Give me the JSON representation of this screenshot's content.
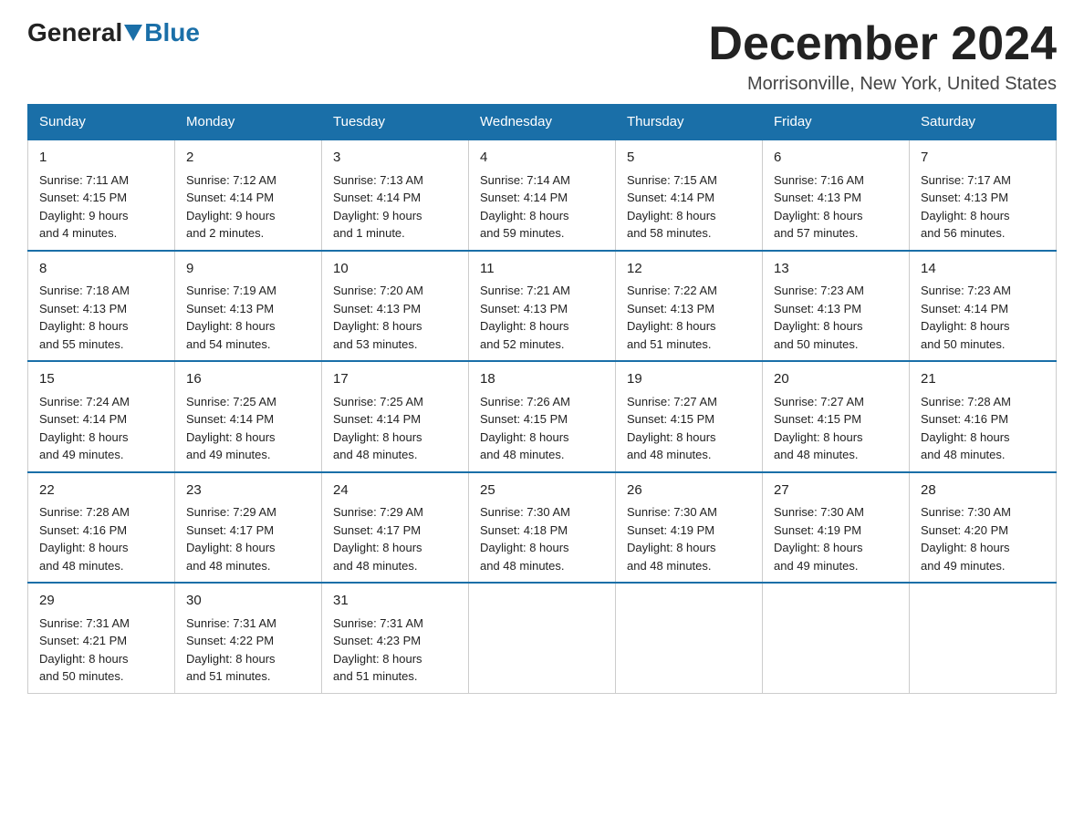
{
  "header": {
    "logo_general": "General",
    "logo_blue": "Blue",
    "title": "December 2024",
    "subtitle": "Morrisonville, New York, United States"
  },
  "days_of_week": [
    "Sunday",
    "Monday",
    "Tuesday",
    "Wednesday",
    "Thursday",
    "Friday",
    "Saturday"
  ],
  "weeks": [
    [
      {
        "day": "1",
        "sunrise": "Sunrise: 7:11 AM",
        "sunset": "Sunset: 4:15 PM",
        "daylight": "Daylight: 9 hours",
        "daylight2": "and 4 minutes."
      },
      {
        "day": "2",
        "sunrise": "Sunrise: 7:12 AM",
        "sunset": "Sunset: 4:14 PM",
        "daylight": "Daylight: 9 hours",
        "daylight2": "and 2 minutes."
      },
      {
        "day": "3",
        "sunrise": "Sunrise: 7:13 AM",
        "sunset": "Sunset: 4:14 PM",
        "daylight": "Daylight: 9 hours",
        "daylight2": "and 1 minute."
      },
      {
        "day": "4",
        "sunrise": "Sunrise: 7:14 AM",
        "sunset": "Sunset: 4:14 PM",
        "daylight": "Daylight: 8 hours",
        "daylight2": "and 59 minutes."
      },
      {
        "day": "5",
        "sunrise": "Sunrise: 7:15 AM",
        "sunset": "Sunset: 4:14 PM",
        "daylight": "Daylight: 8 hours",
        "daylight2": "and 58 minutes."
      },
      {
        "day": "6",
        "sunrise": "Sunrise: 7:16 AM",
        "sunset": "Sunset: 4:13 PM",
        "daylight": "Daylight: 8 hours",
        "daylight2": "and 57 minutes."
      },
      {
        "day": "7",
        "sunrise": "Sunrise: 7:17 AM",
        "sunset": "Sunset: 4:13 PM",
        "daylight": "Daylight: 8 hours",
        "daylight2": "and 56 minutes."
      }
    ],
    [
      {
        "day": "8",
        "sunrise": "Sunrise: 7:18 AM",
        "sunset": "Sunset: 4:13 PM",
        "daylight": "Daylight: 8 hours",
        "daylight2": "and 55 minutes."
      },
      {
        "day": "9",
        "sunrise": "Sunrise: 7:19 AM",
        "sunset": "Sunset: 4:13 PM",
        "daylight": "Daylight: 8 hours",
        "daylight2": "and 54 minutes."
      },
      {
        "day": "10",
        "sunrise": "Sunrise: 7:20 AM",
        "sunset": "Sunset: 4:13 PM",
        "daylight": "Daylight: 8 hours",
        "daylight2": "and 53 minutes."
      },
      {
        "day": "11",
        "sunrise": "Sunrise: 7:21 AM",
        "sunset": "Sunset: 4:13 PM",
        "daylight": "Daylight: 8 hours",
        "daylight2": "and 52 minutes."
      },
      {
        "day": "12",
        "sunrise": "Sunrise: 7:22 AM",
        "sunset": "Sunset: 4:13 PM",
        "daylight": "Daylight: 8 hours",
        "daylight2": "and 51 minutes."
      },
      {
        "day": "13",
        "sunrise": "Sunrise: 7:23 AM",
        "sunset": "Sunset: 4:13 PM",
        "daylight": "Daylight: 8 hours",
        "daylight2": "and 50 minutes."
      },
      {
        "day": "14",
        "sunrise": "Sunrise: 7:23 AM",
        "sunset": "Sunset: 4:14 PM",
        "daylight": "Daylight: 8 hours",
        "daylight2": "and 50 minutes."
      }
    ],
    [
      {
        "day": "15",
        "sunrise": "Sunrise: 7:24 AM",
        "sunset": "Sunset: 4:14 PM",
        "daylight": "Daylight: 8 hours",
        "daylight2": "and 49 minutes."
      },
      {
        "day": "16",
        "sunrise": "Sunrise: 7:25 AM",
        "sunset": "Sunset: 4:14 PM",
        "daylight": "Daylight: 8 hours",
        "daylight2": "and 49 minutes."
      },
      {
        "day": "17",
        "sunrise": "Sunrise: 7:25 AM",
        "sunset": "Sunset: 4:14 PM",
        "daylight": "Daylight: 8 hours",
        "daylight2": "and 48 minutes."
      },
      {
        "day": "18",
        "sunrise": "Sunrise: 7:26 AM",
        "sunset": "Sunset: 4:15 PM",
        "daylight": "Daylight: 8 hours",
        "daylight2": "and 48 minutes."
      },
      {
        "day": "19",
        "sunrise": "Sunrise: 7:27 AM",
        "sunset": "Sunset: 4:15 PM",
        "daylight": "Daylight: 8 hours",
        "daylight2": "and 48 minutes."
      },
      {
        "day": "20",
        "sunrise": "Sunrise: 7:27 AM",
        "sunset": "Sunset: 4:15 PM",
        "daylight": "Daylight: 8 hours",
        "daylight2": "and 48 minutes."
      },
      {
        "day": "21",
        "sunrise": "Sunrise: 7:28 AM",
        "sunset": "Sunset: 4:16 PM",
        "daylight": "Daylight: 8 hours",
        "daylight2": "and 48 minutes."
      }
    ],
    [
      {
        "day": "22",
        "sunrise": "Sunrise: 7:28 AM",
        "sunset": "Sunset: 4:16 PM",
        "daylight": "Daylight: 8 hours",
        "daylight2": "and 48 minutes."
      },
      {
        "day": "23",
        "sunrise": "Sunrise: 7:29 AM",
        "sunset": "Sunset: 4:17 PM",
        "daylight": "Daylight: 8 hours",
        "daylight2": "and 48 minutes."
      },
      {
        "day": "24",
        "sunrise": "Sunrise: 7:29 AM",
        "sunset": "Sunset: 4:17 PM",
        "daylight": "Daylight: 8 hours",
        "daylight2": "and 48 minutes."
      },
      {
        "day": "25",
        "sunrise": "Sunrise: 7:30 AM",
        "sunset": "Sunset: 4:18 PM",
        "daylight": "Daylight: 8 hours",
        "daylight2": "and 48 minutes."
      },
      {
        "day": "26",
        "sunrise": "Sunrise: 7:30 AM",
        "sunset": "Sunset: 4:19 PM",
        "daylight": "Daylight: 8 hours",
        "daylight2": "and 48 minutes."
      },
      {
        "day": "27",
        "sunrise": "Sunrise: 7:30 AM",
        "sunset": "Sunset: 4:19 PM",
        "daylight": "Daylight: 8 hours",
        "daylight2": "and 49 minutes."
      },
      {
        "day": "28",
        "sunrise": "Sunrise: 7:30 AM",
        "sunset": "Sunset: 4:20 PM",
        "daylight": "Daylight: 8 hours",
        "daylight2": "and 49 minutes."
      }
    ],
    [
      {
        "day": "29",
        "sunrise": "Sunrise: 7:31 AM",
        "sunset": "Sunset: 4:21 PM",
        "daylight": "Daylight: 8 hours",
        "daylight2": "and 50 minutes."
      },
      {
        "day": "30",
        "sunrise": "Sunrise: 7:31 AM",
        "sunset": "Sunset: 4:22 PM",
        "daylight": "Daylight: 8 hours",
        "daylight2": "and 51 minutes."
      },
      {
        "day": "31",
        "sunrise": "Sunrise: 7:31 AM",
        "sunset": "Sunset: 4:23 PM",
        "daylight": "Daylight: 8 hours",
        "daylight2": "and 51 minutes."
      },
      {
        "day": "",
        "sunrise": "",
        "sunset": "",
        "daylight": "",
        "daylight2": ""
      },
      {
        "day": "",
        "sunrise": "",
        "sunset": "",
        "daylight": "",
        "daylight2": ""
      },
      {
        "day": "",
        "sunrise": "",
        "sunset": "",
        "daylight": "",
        "daylight2": ""
      },
      {
        "day": "",
        "sunrise": "",
        "sunset": "",
        "daylight": "",
        "daylight2": ""
      }
    ]
  ]
}
